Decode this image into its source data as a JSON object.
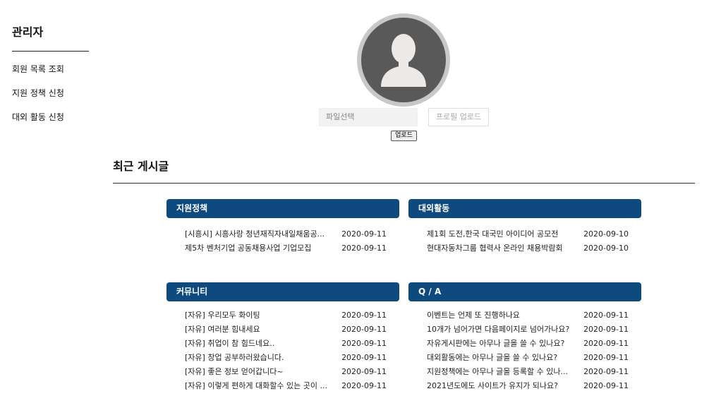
{
  "sidebar": {
    "title": "관리자",
    "items": [
      "회원 목록 조회",
      "지원 정책 신청",
      "대외 활동 신청"
    ]
  },
  "profile": {
    "avatar_icon": "user-silhouette-icon",
    "file_placeholder": "파일선택",
    "profile_upload_label": "프로필 업로드",
    "upload_label": "업로드"
  },
  "recent": {
    "title": "최근 게시글"
  },
  "boards": [
    {
      "name": "지원정책",
      "posts": [
        {
          "title": "[시흥시] 시흥사랑 청년재직자내일채움공...",
          "date": "2020-09-11"
        },
        {
          "title": "제5차 벤처기업 공동채용사업 기업모집",
          "date": "2020-09-11"
        }
      ]
    },
    {
      "name": "대외활동",
      "posts": [
        {
          "title": "제1회 도전,한국 대국민 아이디어 공모전",
          "date": "2020-09-10"
        },
        {
          "title": "현대자동차그룹 협력사 온라인 채용박람회",
          "date": "2020-09-10"
        }
      ]
    },
    {
      "name": "커뮤니티",
      "posts": [
        {
          "title": "[자유] 우리모두 화이팅",
          "date": "2020-09-11"
        },
        {
          "title": "[자유] 여러분 힘내세요",
          "date": "2020-09-11"
        },
        {
          "title": "[자유] 취업이 참 힘드네요..",
          "date": "2020-09-11"
        },
        {
          "title": "[자유] 창업 공부하러왔습니다.",
          "date": "2020-09-11"
        },
        {
          "title": "[자유] 좋은 정보 얻어갑니다~",
          "date": "2020-09-11"
        },
        {
          "title": "[자유] 이렇게 편하게 대화할수 있는 곳이 ...",
          "date": "2020-09-11"
        }
      ]
    },
    {
      "name": "Q / A",
      "posts": [
        {
          "title": "이벤트는 언제 또 진행하나요",
          "date": "2020-09-11"
        },
        {
          "title": "10개가 넘어가면 다음페이지로 넘어가나요?",
          "date": "2020-09-11"
        },
        {
          "title": "자유게시판에는 아무나 글을 쓸 수 있나요?",
          "date": "2020-09-11"
        },
        {
          "title": "대외활동에는 아무나 글을 쓸 수 있나요?",
          "date": "2020-09-11"
        },
        {
          "title": "지원정책에는 아무나 글을 등록할 수 있나...",
          "date": "2020-09-11"
        },
        {
          "title": "2021년도에도 사이트가 유지가 되나요?",
          "date": "2020-09-11"
        }
      ]
    }
  ]
}
